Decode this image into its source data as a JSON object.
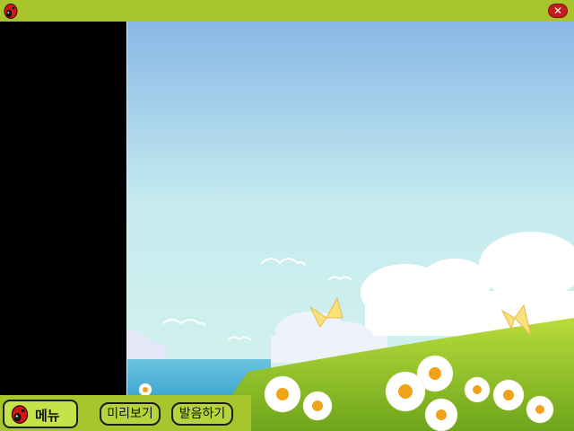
{
  "title_bar": {
    "app_icon": "ladybug-icon",
    "close_icon": "close-icon",
    "close_glyph": "✕"
  },
  "bottom_bar": {
    "menu_button": {
      "label": "메뉴",
      "icon": "ladybug-icon"
    },
    "preview_button": {
      "label": "미리보기"
    },
    "pronounce_button": {
      "label": "발음하기"
    }
  },
  "colors": {
    "accent_green": "#a8c52c",
    "close_red": "#c41e1e",
    "sky_top": "#89b7e6",
    "sky_bottom": "#d2f0ee"
  }
}
